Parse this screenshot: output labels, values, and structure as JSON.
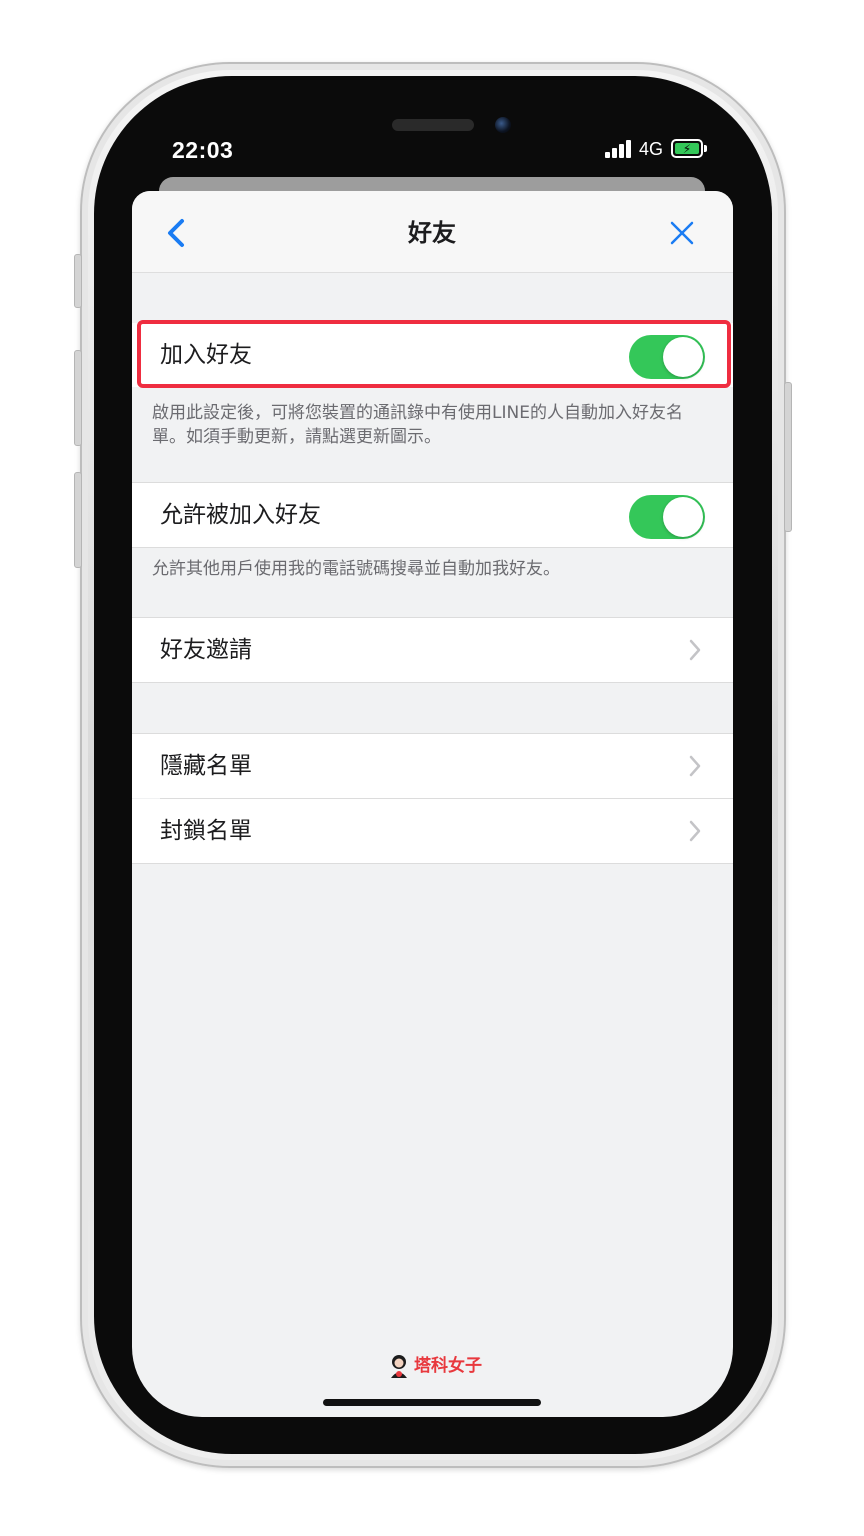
{
  "status_bar": {
    "time": "22:03",
    "network": "4G",
    "battery_icon": "battery-charging-icon",
    "signal_icon": "cellular-signal-icon"
  },
  "nav": {
    "title": "好友",
    "back_icon": "chevron-left-icon",
    "close_icon": "close-icon"
  },
  "settings": {
    "add_friends": {
      "label": "加入好友",
      "enabled": true,
      "description": "啟用此設定後，可將您裝置的通訊錄中有使用LINE的人自動加入好友名單。如須手動更新，請點選更新圖示。"
    },
    "allow_added": {
      "label": "允許被加入好友",
      "enabled": true,
      "description": "允許其他用戶使用我的電話號碼搜尋並自動加我好友。"
    },
    "friend_requests": {
      "label": "好友邀請"
    },
    "hidden_list": {
      "label": "隱藏名單"
    },
    "blocked_list": {
      "label": "封鎖名單"
    }
  },
  "watermark": {
    "text": "塔科女子"
  },
  "colors": {
    "accent": "#1a7cf3",
    "toggle_on": "#34c759",
    "highlight": "#ef2d40",
    "background": "#f1f2f3"
  }
}
